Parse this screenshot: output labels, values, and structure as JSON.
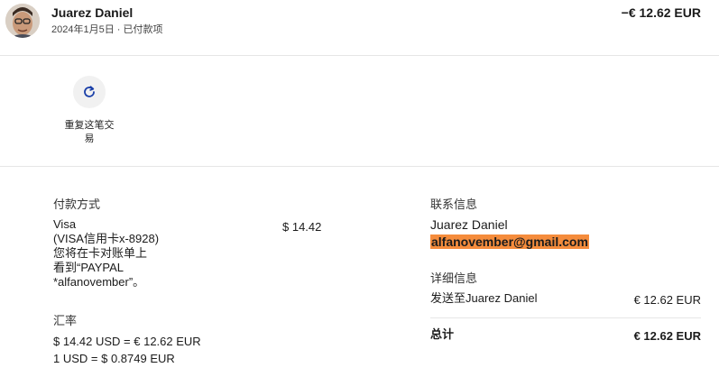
{
  "header": {
    "name": "Juarez Daniel",
    "date": "2024年1月5日",
    "separator": "·",
    "status": "已付款项",
    "amount": "−€ 12.62 EUR"
  },
  "actions": {
    "repeat_label": "重复这笔交易"
  },
  "payment": {
    "heading": "付款方式",
    "method_line1": "Visa",
    "method_line2": "(VISA信用卡x-8928)",
    "method_line3": "您将在卡对账单上",
    "method_line4": "看到“PAYPAL",
    "method_line5": "*alfanovember”。",
    "amount": "$ 14.42"
  },
  "exchange": {
    "heading": "汇率",
    "line1": "$ 14.42 USD = € 12.62 EUR",
    "line2": "1 USD = $ 0.8749 EUR"
  },
  "contact": {
    "heading": "联系信息",
    "name": "Juarez Daniel",
    "email": "alfanovember@gmail.com"
  },
  "details": {
    "heading": "详细信息",
    "sent_to": "发送至Juarez Daniel",
    "sent_amount": "€ 12.62 EUR",
    "total_label": "总计",
    "total_amount": "€ 12.62 EUR"
  },
  "colors": {
    "email_highlight": "#f58c3c",
    "icon_blue": "#1a3fa8"
  }
}
